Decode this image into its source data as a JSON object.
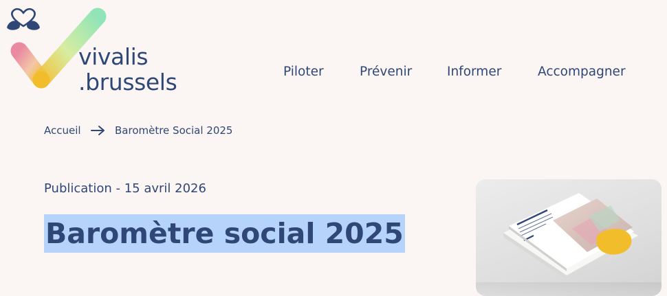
{
  "logo": {
    "line1": "vivalis",
    "line2": ".brussels"
  },
  "nav": {
    "items": [
      {
        "label": "Piloter"
      },
      {
        "label": "Prévenir"
      },
      {
        "label": "Informer"
      },
      {
        "label": "Accompagner"
      }
    ]
  },
  "breadcrumb": {
    "home": "Accueil",
    "current": "Baromètre Social 2025"
  },
  "publication": {
    "date_label": "Publication - 15 avril 2026"
  },
  "page": {
    "title": "Baromètre social 2025"
  },
  "cover": {
    "title_line": "BAROMÈTRE SOCIAL",
    "year": "2025"
  },
  "colors": {
    "background": "#fbf6f3",
    "text": "#2f4777",
    "selection": "#b6d4fb",
    "accent_yellow": "#f2bd2b",
    "accent_pink": "#e98aa0",
    "accent_green": "#8fe3b2"
  }
}
